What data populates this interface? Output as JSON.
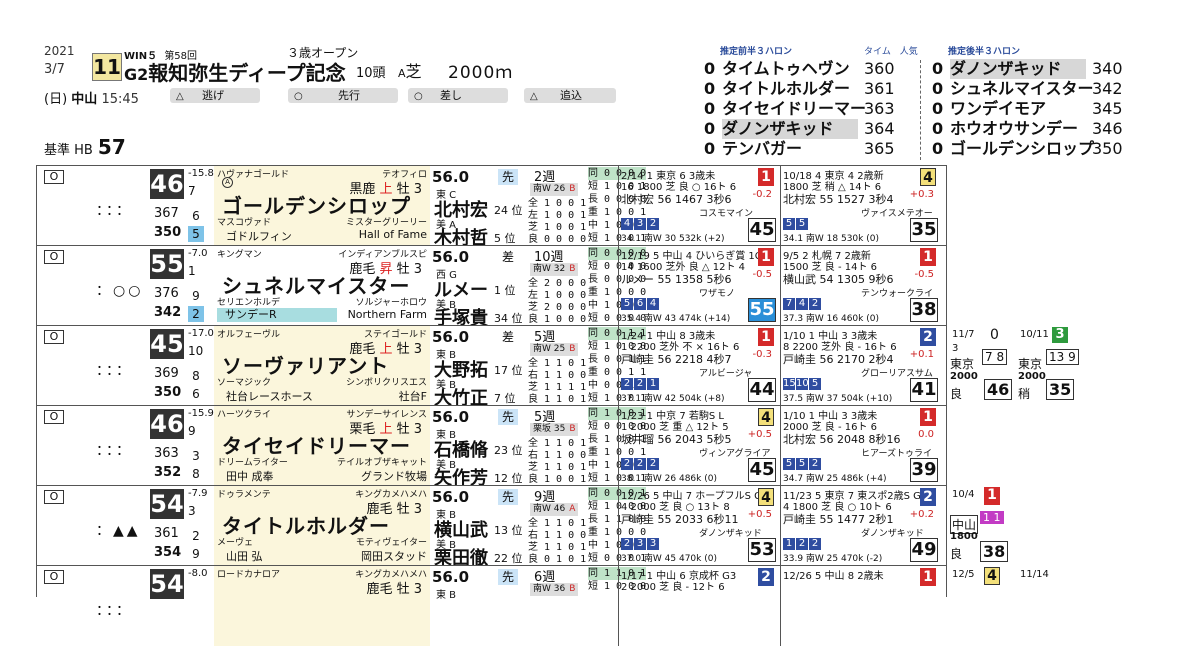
{
  "header": {
    "year": "2021",
    "date": "3/7",
    "day": "(日)",
    "venue": "中山",
    "time": "15:45",
    "race_no": "11",
    "win5": "WIN５",
    "series": "第58回",
    "grade": "G2",
    "race_name": "報知弥生ディープ記念",
    "cond": "３歳オープン",
    "heads": "10頭",
    "course_a": "A",
    "surface": "芝",
    "distance": "2000ｍ",
    "base_label": "基準 HB",
    "base_value": "57",
    "pills": [
      {
        "icon": "△",
        "label": "逃げ"
      },
      {
        "icon": "○",
        "label": "先行"
      },
      {
        "icon": "○",
        "label": "差し"
      },
      {
        "icon": "△",
        "label": "追込"
      }
    ]
  },
  "ratings": {
    "front_title": "推定前半３ハロン",
    "time_label": "タイム",
    "pop_label": "人気",
    "back_title": "推定後半３ハロン",
    "front": [
      {
        "z": "0",
        "name": "タイムトゥヘヴン",
        "v": "360"
      },
      {
        "z": "0",
        "name": "タイトルホルダー",
        "v": "361"
      },
      {
        "z": "0",
        "name": "タイセイドリーマー",
        "v": "363"
      },
      {
        "z": "0",
        "name": "ダノンザキッド",
        "v": "364"
      },
      {
        "z": "0",
        "name": "テンバガー",
        "v": "365"
      }
    ],
    "back": [
      {
        "z": "0",
        "name": "ダノンザキッド",
        "v": "340"
      },
      {
        "z": "0",
        "name": "シュネルマイスター",
        "v": "342"
      },
      {
        "z": "0",
        "name": "ワンデイモア",
        "v": "345"
      },
      {
        "z": "0",
        "name": "ホウオウサンデー",
        "v": "346"
      },
      {
        "z": "0",
        "name": "ゴールデンシロップ",
        "v": "350"
      }
    ]
  },
  "rows": [
    {
      "waku": "O",
      "marks": "：：：",
      "index": "46",
      "idx_sub": "-15.8",
      "idx_rank": "7",
      "n_a": "367",
      "sq_a": "6",
      "n_b": "350",
      "sq_b": "5",
      "sq_b_color": "blue",
      "sire": "ハヴァナゴールド",
      "dam_sire": "テオフィロ",
      "badge": "Ⓐ",
      "coat": "黒鹿",
      "coat_hi": "上",
      "sex_age": "牡 3",
      "name": "ゴールデンシロップ",
      "dam": "マスコヴァド",
      "dsire": "ミスターグリーリー",
      "owner": "ゴドルフィン",
      "breeder": "Hall of Fame",
      "alt": false,
      "color_band": "",
      "weight": "56.0",
      "style": "先",
      "style_c": "b",
      "stable": "東 C",
      "jockey1": "北村宏",
      "jk1p": "24 位",
      "sub2": "美 A",
      "jockey2": "木村哲",
      "jk2p": "5 位",
      "weeks": "2週",
      "wkbar": "南W 26",
      "wkbar_mark": "B",
      "recs": [
        "全 1 0 0 1",
        "左 1 0 0 1",
        "芝 1 0 0 1",
        "良 0 0 0 0"
      ],
      "recs2": [
        "同 0 0 0 0",
        "短 1 0 0 1",
        "長 0 0 0 0",
        "重 1 0 0 1",
        "中 1 0 0 1",
        "短 1 0 0 1"
      ],
      "past": [
        {
          "d": "2/14 1 東京 6 3歳未",
          "place": "1",
          "pc": "p1",
          "l2": "16 1800 芝 良 ○ 16ト 6",
          "l3": "北村宏 56 1467 3秒6",
          "delta": "-0.2",
          "l4": "コスモマイン",
          "l5": [
            "4",
            "3",
            "2"
          ],
          "l6": "34.1 南W 30 532k (+2)",
          "score": "45",
          "hi": false
        },
        {
          "d": "10/18 4 東京 4 2歳新",
          "place": "4",
          "pc": "p4",
          "l2": "1800 芝 稍 △ 14ト 6",
          "l3": "北村宏 55 1527 3秒4",
          "delta": "+0.3",
          "l4": "ヴァイスメテオー",
          "l5": [
            "5",
            "5"
          ],
          "l6": "34.1 南W 18 530k (0)",
          "score": "35",
          "hi": false
        }
      ]
    },
    {
      "waku": "O",
      "marks": "：○○",
      "index": "55",
      "idx_sub": "-7.0",
      "idx_rank": "1",
      "n_a": "376",
      "sq_a": "9",
      "n_b": "342",
      "sq_b": "2",
      "sq_b_color": "blue",
      "sire": "キングマン",
      "dam_sire": "インディアンブルスピ",
      "badge": "",
      "coat": "鹿毛",
      "coat_hi": "昇",
      "sex_age": "牡 3",
      "name": "シュネルマイスター",
      "dam": "セリエンホルデ",
      "dsire": "ソルジャーホロウ",
      "owner": "サンデーR",
      "breeder": "Northern Farm",
      "alt": true,
      "color_band": "サンデーR",
      "weight": "56.0",
      "style": "差",
      "style_c": "g",
      "stable": "西 G",
      "jockey1": "ルメー",
      "jk1p": "1 位",
      "sub2": "美 B",
      "jockey2": "手塚貴",
      "jk2p": "34 位",
      "weeks": "10週",
      "wkbar": "南W 32",
      "wkbar_mark": "B",
      "recs": [
        "全 2 0 0 0",
        "左 1 0 0 0",
        "芝 2 0 0 0",
        "良 1 0 0 0"
      ],
      "recs2": [
        "同 0 0 0 0",
        "短 0 0 0 0",
        "長 0 0 0 0",
        "重 1 0 0 0",
        "中 1 0 0 0",
        "短 0 0 0 0"
      ],
      "past": [
        {
          "d": "12/19 5 中山 4 ひいらぎ賞 1C",
          "place": "1",
          "pc": "p1",
          "l2": "14 1600 芝外 良 △ 12ト 4",
          "l3": "ルメー 55 1358 5秒6",
          "delta": "-0.5",
          "l4": "ワザモノ",
          "l5": [
            "5",
            "6",
            "4"
          ],
          "l6": "35.4 南W 43 474k (+14)",
          "score": "55",
          "hi": true
        },
        {
          "d": "9/5 2 札幌 7 2歳新",
          "place": "1",
          "pc": "p1",
          "l2": "1500 芝 良 - 14ト 6",
          "l3": "横山武 54 1305 9秒6",
          "delta": "-0.5",
          "l4": "テンウォークライ",
          "l5": [
            "7",
            "4",
            "2"
          ],
          "l6": "37.3 南W 16 460k (0)",
          "score": "38",
          "hi": false
        }
      ]
    },
    {
      "waku": "O",
      "marks": "：：：",
      "index": "45",
      "idx_sub": "-17.0",
      "idx_rank": "10",
      "n_a": "369",
      "sq_a": "8",
      "n_b": "350",
      "sq_b": "6",
      "sq_b_color": "white",
      "sire": "オルフェーヴル",
      "dam_sire": "ステイゴールド",
      "badge": "",
      "coat": "鹿毛",
      "coat_hi": "上",
      "sex_age": "牡 3",
      "name": "ソーヴァリアント",
      "dam": "ソーマジック",
      "dsire": "シンボリクリスエス",
      "owner": "社台レースホース",
      "breeder": "社台F",
      "alt": false,
      "color_band": "",
      "weight": "56.0",
      "style": "差",
      "style_c": "g",
      "stable": "東 B",
      "jockey1": "大野拓",
      "jk1p": "17 位",
      "sub2": "美 B",
      "jockey2": "大竹正",
      "jk2p": "7 位",
      "weeks": "5週",
      "wkbar": "南W 25",
      "wkbar_mark": "B",
      "recs": [
        "全 1 1 0 1",
        "右 1 1 0 0",
        "芝 1 1 1 1",
        "良 1 1 0 1"
      ],
      "recs2": [
        "同 0 0 1 1",
        "短 1 0 0 0",
        "長 0 0 1 1",
        "重 0 0 1 1",
        "中 0 0 1 1",
        "短 1 0 0 1"
      ],
      "past": [
        {
          "d": "1/24 1 中山 8 3歳未",
          "place": "1",
          "pc": "p1",
          "l2": "1 2200 芝外 不 × 16ト 6",
          "l3": "戸崎圭 56 2218 4秒7",
          "delta": "-0.3",
          "l4": "アルビージャ",
          "l5": [
            "2",
            "2",
            "1"
          ],
          "l6": "37.1 南W 42 504k (+8)",
          "score": "44",
          "hi": false
        },
        {
          "d": "1/10 1 中山 3 3歳未",
          "place": "2",
          "pc": "p2",
          "l2": "8 2200 芝外 良 - 16ト 6",
          "l3": "戸崎圭 56 2170 2秒4",
          "delta": "+0.1",
          "l4": "グローリアスサム",
          "l5": [
            "15",
            "10",
            "5"
          ],
          "l6": "37.5 南W 37 504k (+10)",
          "score": "41",
          "hi": false
        }
      ],
      "extra": {
        "d1": "11/7",
        "z": "0",
        "d2": "10/11",
        "place": "3"
      }
    },
    {
      "waku": "O",
      "marks": "：：：",
      "index": "46",
      "idx_sub": "-15.9",
      "idx_rank": "9",
      "n_a": "363",
      "sq_a": "3",
      "n_b": "352",
      "sq_b": "8",
      "sq_b_color": "white",
      "sire": "ハーツクライ",
      "dam_sire": "サンデーサイレンス",
      "badge": "",
      "coat": "栗毛",
      "coat_hi": "上",
      "sex_age": "牡 3",
      "name": "タイセイドリーマー",
      "dam": "ドリームライター",
      "dsire": "テイルオブザキャット",
      "owner": "田中 成奉",
      "breeder": "グランド牧場",
      "alt": false,
      "color_band": "",
      "weight": "56.0",
      "style": "先",
      "style_c": "b",
      "stable": "東 B",
      "jockey1": "石橋脩",
      "jk1p": "23 位",
      "sub2": "美 B",
      "jockey2": "矢作芳",
      "jk2p": "12 位",
      "weeks": "5週",
      "wkbar": "栗坂 35",
      "wkbar_mark": "B",
      "recs": [
        "全 1 1 0 1",
        "右 1 1 0 0",
        "芝 1 1 0 1",
        "良 1 0 0 1"
      ],
      "recs2": [
        "同 1 0 0 1",
        "短 0 0 0 0",
        "長 1 0 0 1",
        "重 1 0 0 1",
        "中 1 0 0 1",
        "短 1 0 0 1"
      ],
      "past": [
        {
          "d": "1/23 1 中京 7 若駒S L",
          "place": "4",
          "pc": "p4",
          "l2": "1 2000 芝 重 △ 12ト 5",
          "l3": "坂井瑠 56 2043 5秒5",
          "delta": "+0.5",
          "l4": "ヴィンアグライア",
          "l5": [
            "2",
            "2",
            "2"
          ],
          "l6": "38.1 南W 26 486k (0)",
          "score": "45",
          "hi": false
        },
        {
          "d": "1/10 1 中山 3 3歳未",
          "place": "1",
          "pc": "p1",
          "l2": "2000 芝 良 - 16ト 6",
          "l3": "北村宏 56 2048 8秒16",
          "delta": "0.0",
          "l4": "ヒアーズトゥライ",
          "l5": [
            "5",
            "5",
            "2"
          ],
          "l6": "34.7 南W 25 486k (+4)",
          "score": "39",
          "hi": false
        }
      ]
    },
    {
      "waku": "O",
      "marks": "：▲▲",
      "index": "54",
      "idx_sub": "-7.9",
      "idx_rank": "3",
      "n_a": "361",
      "sq_a": "2",
      "n_b": "354",
      "sq_b": "9",
      "sq_b_color": "white",
      "sire": "ドゥラメンテ",
      "dam_sire": "キングカメハメハ",
      "badge": "",
      "coat": "鹿毛",
      "coat_hi": "",
      "sex_age": "牡 3",
      "name": "タイトルホルダー",
      "dam": "メーヴェ",
      "dsire": "モティヴェイター",
      "owner": "山田 弘",
      "breeder": "岡田スタッド",
      "alt": false,
      "color_band": "",
      "weight": "56.0",
      "style": "先",
      "style_c": "b",
      "stable": "東 B",
      "jockey1": "横山武",
      "jk1p": "13 位",
      "sub2": "美 B",
      "jockey2": "栗田徹",
      "jk2p": "22 位",
      "weeks": "9週",
      "wkbar": "南W 46",
      "wkbar_mark": "A",
      "recs": [
        "全 1 1 0 1",
        "右 1 1 0 0",
        "芝 1 1 0 1",
        "良 0 1 0 1"
      ],
      "recs2": [
        "同 0 0 0 1",
        "短 1 0 0 0",
        "長 1 1 0 0",
        "重 1 0 0 0",
        "中 1 0 0 0",
        "短 0 0 0 1"
      ],
      "past": [
        {
          "d": "12/26 5 中山 7 ホープフルS G1",
          "place": "4",
          "pc": "p4",
          "l2": "4 2000 芝 良 ○ 13ト 8",
          "l3": "戸崎圭 55 2033 6秒11",
          "delta": "+0.5",
          "l4": "ダノンザキッド",
          "l5": [
            "2",
            "3",
            "3"
          ],
          "l6": "37.0 南W 45 470k (0)",
          "score": "53",
          "hi": false
        },
        {
          "d": "11/23 5 東京 7 東スポ2歳S G3",
          "place": "2",
          "pc": "p2",
          "l2": "4 1800 芝 良 ○ 10ト 6",
          "l3": "戸崎圭 55 1477 2秒1",
          "delta": "+0.2",
          "l4": "ダノンザキッド",
          "l5": [
            "1",
            "2",
            "2"
          ],
          "l6": "33.9 南W 25 470k (-2)",
          "score": "49",
          "hi": false
        }
      ],
      "extra": {
        "d1": "10/4",
        "place": "1"
      }
    },
    {
      "waku": "O",
      "marks": "：：：",
      "index": "54",
      "idx_sub": "-8.0",
      "idx_rank": "",
      "n_a": "",
      "sq_a": "",
      "n_b": "",
      "sq_b": "",
      "sq_b_color": "white",
      "sire": "ロードカナロア",
      "dam_sire": "キングカメハメハ",
      "badge": "",
      "coat": "鹿毛",
      "coat_hi": "",
      "sex_age": "牡 3",
      "name": "",
      "dam": "",
      "dsire": "",
      "owner": "",
      "breeder": "",
      "alt": false,
      "color_band": "",
      "weight": "56.0",
      "style": "先",
      "style_c": "b",
      "stable": "東 B",
      "jockey1": "",
      "jk1p": "",
      "sub2": "",
      "jockey2": "",
      "jk2p": "",
      "weeks": "6週",
      "wkbar": "南W 36",
      "wkbar_mark": "B",
      "recs": [],
      "recs2": [
        "同 1 1 0 1",
        "短 1 0 0 0"
      ],
      "past": [
        {
          "d": "1/17 1 中山 6 京成杯 G3",
          "place": "2",
          "pc": "p2",
          "l2": "2 2000 芝 良 - 12ト 6",
          "l3": "",
          "delta": "",
          "l4": "",
          "l5": [],
          "l6": "",
          "score": "",
          "hi": false
        },
        {
          "d": "12/26 5 中山 8 2歳未",
          "place": "1",
          "pc": "p1",
          "l2": "",
          "l3": "",
          "delta": "",
          "l4": "",
          "l5": [],
          "l6": "",
          "score": "",
          "hi": false
        }
      ],
      "extra": {
        "d1": "12/5",
        "place": "4",
        "d2": "11/14"
      }
    }
  ],
  "row3_extra": {
    "a": "3",
    "b": "東京",
    "c": "2000",
    "d": "良",
    "e": "東京",
    "f": "2000",
    "g": "稍",
    "sc1": "46",
    "sc2": "35",
    "n1": "7 8",
    "n2": "13 9"
  },
  "row5_extra": {
    "venue": "中山",
    "dist": "1800",
    "cond": "良",
    "score": "38",
    "n": "1 1"
  }
}
